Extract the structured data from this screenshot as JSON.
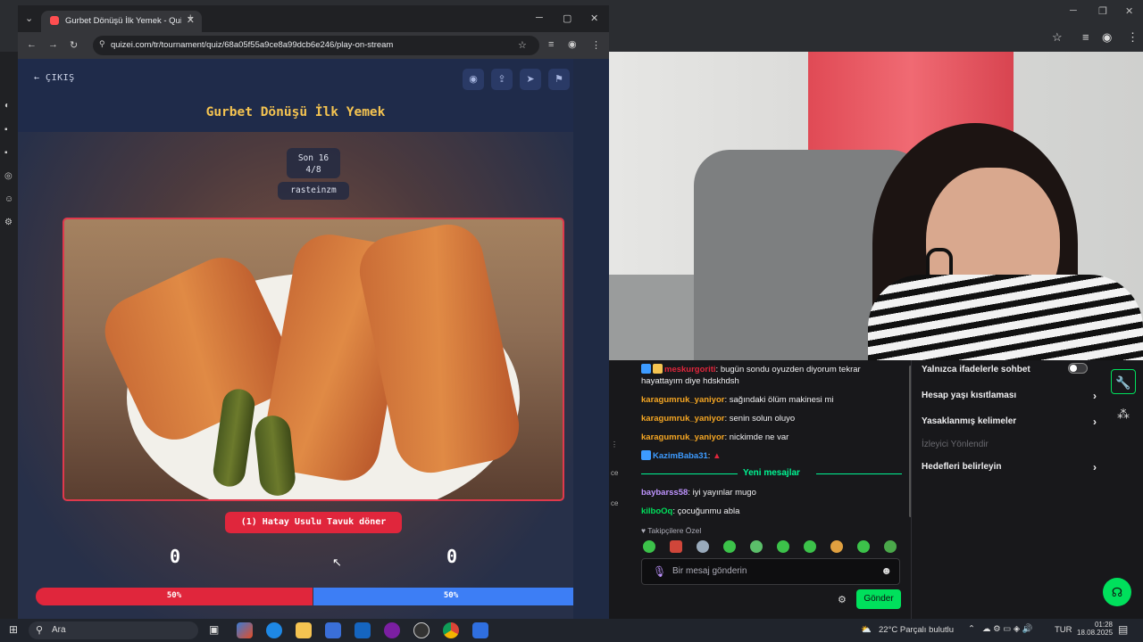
{
  "browser_main": {
    "tab_title": "Gurbet Dönüşü İlk Yemek - Quiz",
    "url": "quizei.com/tr/tournament/quiz/68a05f55a9ce8a99dcb6e246/play-on-stream"
  },
  "quiz": {
    "exit_label": "ÇIKIŞ",
    "title": "Gurbet Dönüşü İlk Yemek",
    "round_name": "Son 16",
    "round_progress": "4/8",
    "username": "rasteinzm",
    "answer_label": "(1) Hatay Usulu Tavuk döner",
    "score_left": "0",
    "score_right": "0",
    "vote_left_pct": "50%",
    "vote_right_pct": "50%",
    "vote_left_fraction": 0.5
  },
  "chat": {
    "messages": [
      {
        "user": "meskurgoriti",
        "text": "bugün sondu oyuzden diyorum tekrar hayattayım diye hdskhdsh",
        "color": "#e0263c"
      },
      {
        "user": "karagumruk_yaniyor",
        "text": "sağındaki ölüm makinesi mi",
        "color": "#f5a623"
      },
      {
        "user": "karagumruk_yaniyor",
        "text": "senin solun oluyo",
        "color": "#f5a623"
      },
      {
        "user": "karagumruk_yaniyor",
        "text": "nickimde ne var",
        "color": "#f5a623"
      },
      {
        "user": "KazimBaba31",
        "text": "",
        "color": "#3d9bff"
      }
    ],
    "new_messages_label": "Yeni mesajlar",
    "new_messages": [
      {
        "user": "baybarss58",
        "text": "iyi yayınlar mugo",
        "color": "#bf94ff"
      },
      {
        "user": "kilboOq",
        "text": "çocuğunmu abla",
        "color": "#00e05c"
      }
    ],
    "emote_section_label": "Takipçilere Özel",
    "input_placeholder": "Bir mesaj gönderin",
    "send_label": "Gönder"
  },
  "settings": {
    "items": [
      {
        "label": "Yalnızca ifadelerle sohbet",
        "type": "toggle"
      },
      {
        "label": "Hesap yaşı kısıtlaması",
        "type": "arrow"
      },
      {
        "label": "Yasaklanmış kelimeler",
        "type": "arrow"
      },
      {
        "label": "İzleyici Yönlendir",
        "type": "dim"
      },
      {
        "label": "Hedefleri belirleyin",
        "type": "arrow"
      }
    ]
  },
  "taskbar": {
    "search_placeholder": "Ara",
    "weather": "22°C  Parçalı bulutlu",
    "language": "TUR",
    "time": "01:28",
    "date": "18.08.2025"
  },
  "colors": {
    "accent_red": "#e0263c",
    "accent_blue": "#3d7ef5",
    "title_yellow": "#f5c451",
    "twitch_green": "#00e05c"
  }
}
